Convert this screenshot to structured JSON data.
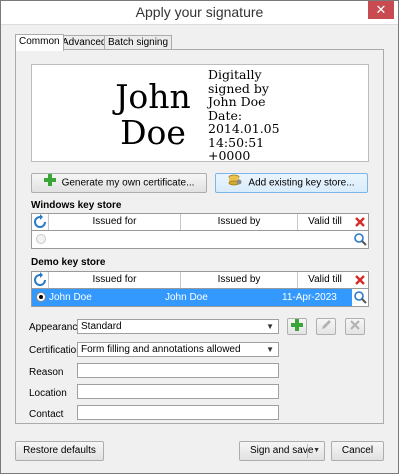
{
  "window": {
    "title": "Apply your signature",
    "close_glyph": "✕"
  },
  "tabs": [
    {
      "label": "Common",
      "active": true
    },
    {
      "label": "Advanced",
      "active": false
    },
    {
      "label": "Batch signing",
      "active": false
    }
  ],
  "signature_preview": {
    "name": "John Doe",
    "details": "Digitally\nsigned by\nJohn Doe\nDate:\n2014.01.05\n14:50:51\n+0000"
  },
  "actions": {
    "generate_label": "Generate my own certificate...",
    "generate_icon": "green-plus-icon",
    "add_keystore_label": "Add existing key store...",
    "add_keystore_icon": "keystore-icon"
  },
  "windows_store": {
    "title": "Windows key store",
    "columns": [
      "Issued for",
      "Issued by",
      "Valid till"
    ],
    "rows": []
  },
  "demo_store": {
    "title": "Demo key store",
    "columns": [
      "Issued for",
      "Issued by",
      "Valid till"
    ],
    "rows": [
      {
        "issued_for": "John Doe",
        "issued_by": "John Doe",
        "valid_till": "11-Apr-2023",
        "selected": true
      }
    ]
  },
  "form": {
    "appearance_label": "Appearance",
    "appearance_value": "Standard",
    "certification_label": "Certification",
    "certification_value": "Form filling and annotations allowed",
    "reason_label": "Reason",
    "reason_value": "",
    "location_label": "Location",
    "location_value": "",
    "contact_label": "Contact",
    "contact_value": ""
  },
  "footer": {
    "restore_label": "Restore defaults",
    "sign_save_label": "Sign and save",
    "cancel_label": "Cancel"
  },
  "colors": {
    "selection": "#3399ff",
    "add_green": "#3aa63a",
    "delete_red": "#d42b2b",
    "refresh_blue": "#2a78c8"
  }
}
